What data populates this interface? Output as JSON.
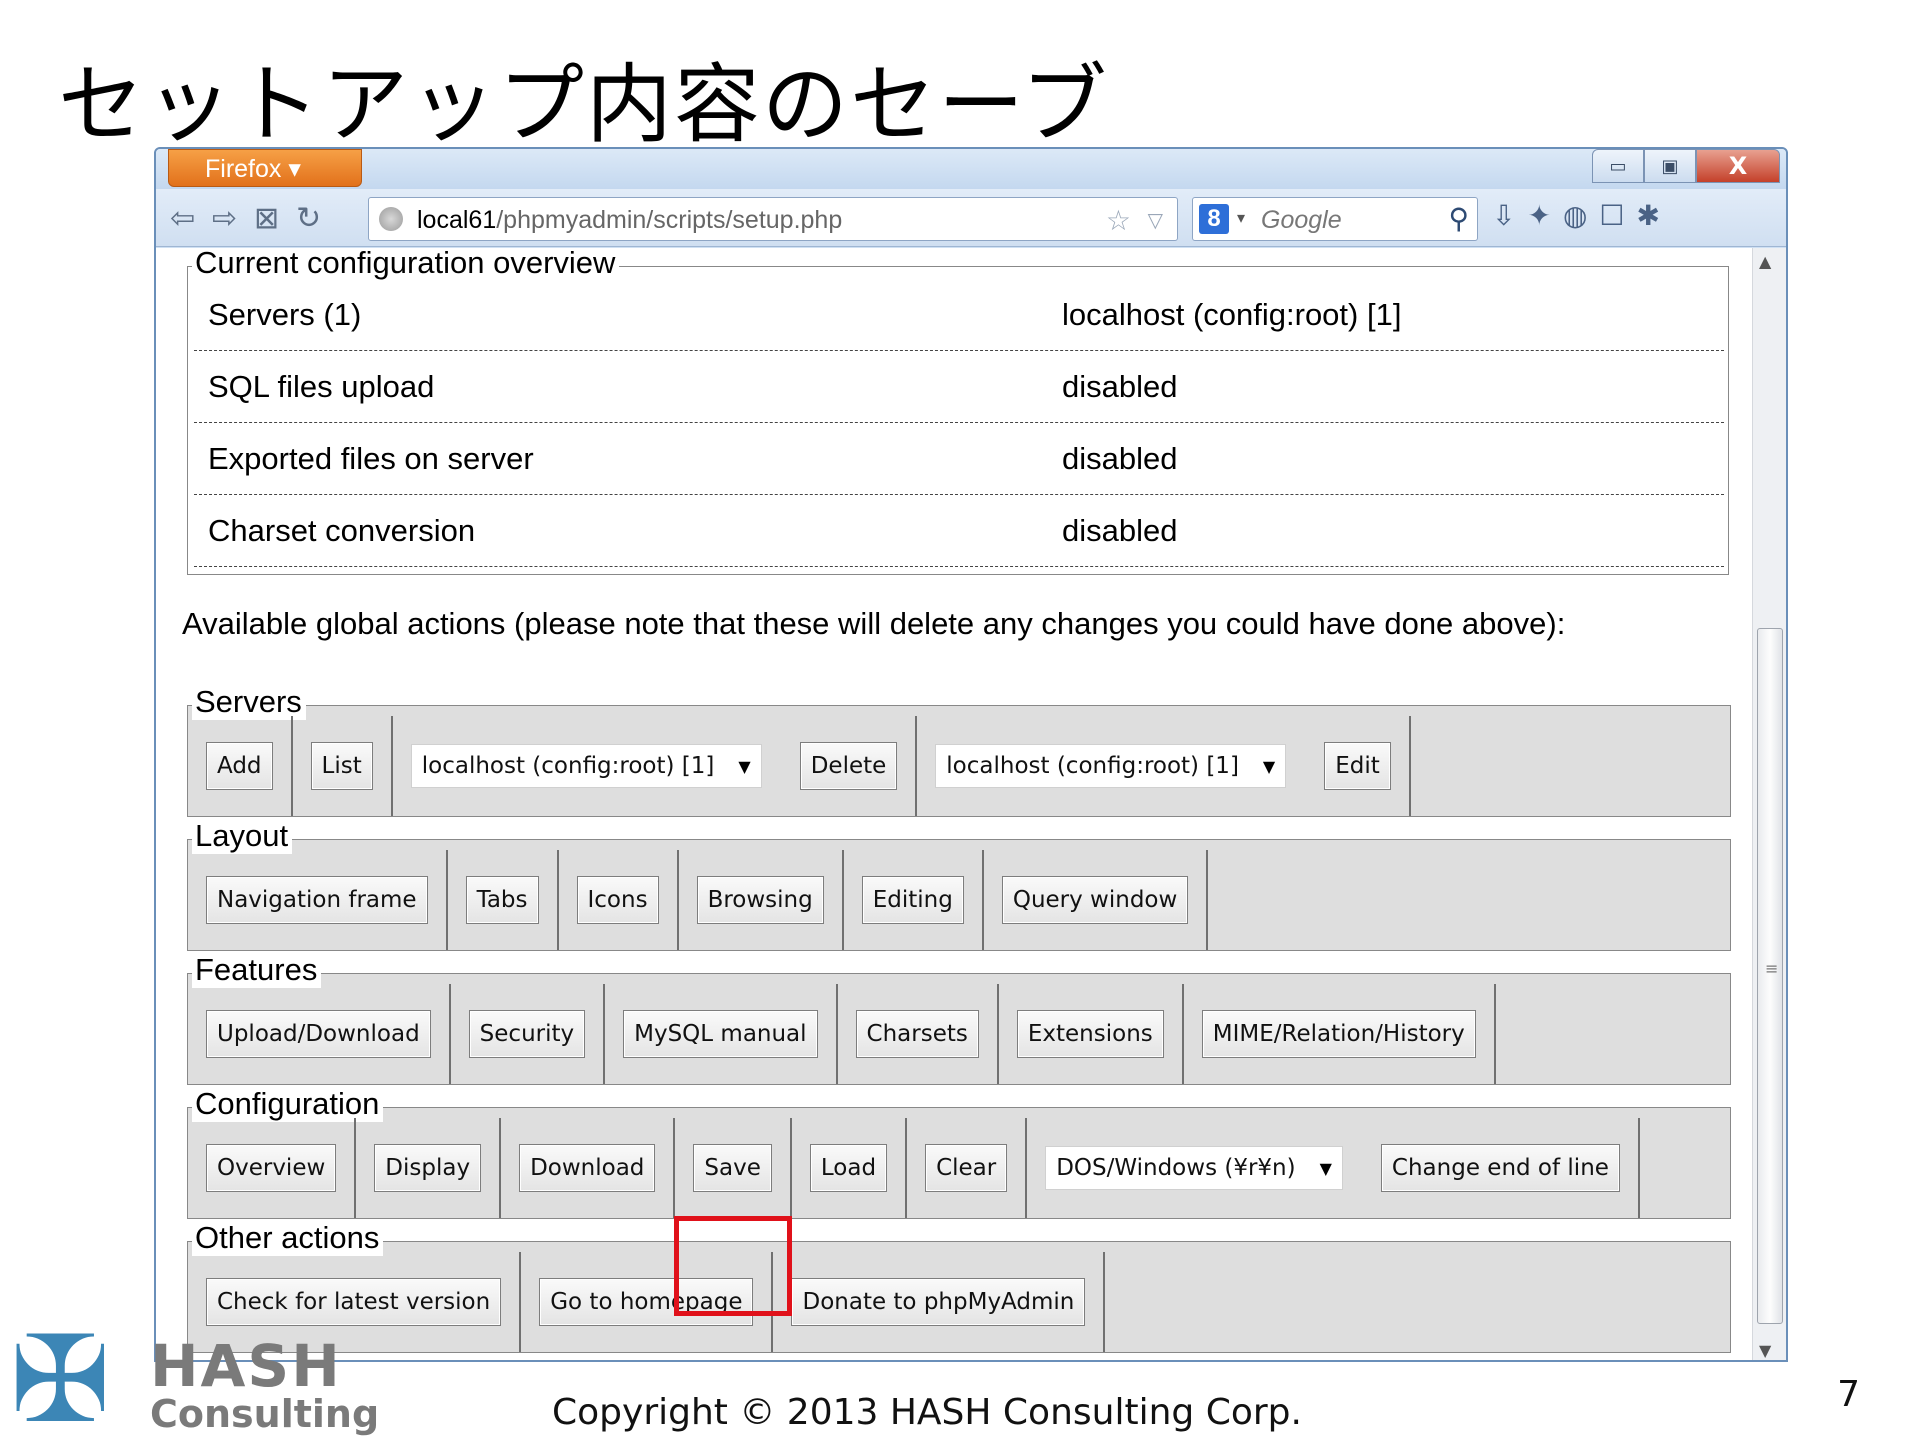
{
  "slide": {
    "title": "セットアップ内容のセーブ",
    "copyright": "Copyright © 2013 HASH Consulting Corp.",
    "page_number": "7",
    "logo": {
      "name": "HASH",
      "subtitle": "Consulting"
    }
  },
  "browser": {
    "app_button": "Firefox ▾",
    "window_controls": {
      "minimize": "▭",
      "maximize": "▣",
      "close": "X"
    },
    "url_host": "local61",
    "url_path": "/phpmyadmin/scripts/setup.php",
    "search_engine_label": "8",
    "search_placeholder": "Google"
  },
  "overview": {
    "legend": "Current configuration overview",
    "rows": [
      {
        "name": "Servers (1)",
        "value": "localhost (config:root) [1]"
      },
      {
        "name": "SQL files upload",
        "value": "disabled"
      },
      {
        "name": "Exported files on server",
        "value": "disabled"
      },
      {
        "name": "Charset conversion",
        "value": "disabled"
      }
    ]
  },
  "global_actions_note": "Available global actions (please note that these will delete any changes you could have done above):",
  "servers": {
    "legend": "Servers",
    "add": "Add",
    "list": "List",
    "select_1": "localhost (config:root) [1]",
    "delete": "Delete",
    "select_2": "localhost (config:root) [1]",
    "edit": "Edit"
  },
  "layout": {
    "legend": "Layout",
    "buttons": [
      "Navigation frame",
      "Tabs",
      "Icons",
      "Browsing",
      "Editing",
      "Query window"
    ]
  },
  "features": {
    "legend": "Features",
    "buttons": [
      "Upload/Download",
      "Security",
      "MySQL manual",
      "Charsets",
      "Extensions",
      "MIME/Relation/History"
    ]
  },
  "configuration": {
    "legend": "Configuration",
    "overview": "Overview",
    "display": "Display",
    "download": "Download",
    "save": "Save",
    "load": "Load",
    "clear": "Clear",
    "eol_select": "DOS/Windows (¥r¥n)",
    "change_eol": "Change end of line",
    "highlight_color": "#e0111a"
  },
  "other_actions": {
    "legend": "Other actions",
    "buttons": [
      "Check for latest version",
      "Go to homepage",
      "Donate to phpMyAdmin"
    ]
  }
}
